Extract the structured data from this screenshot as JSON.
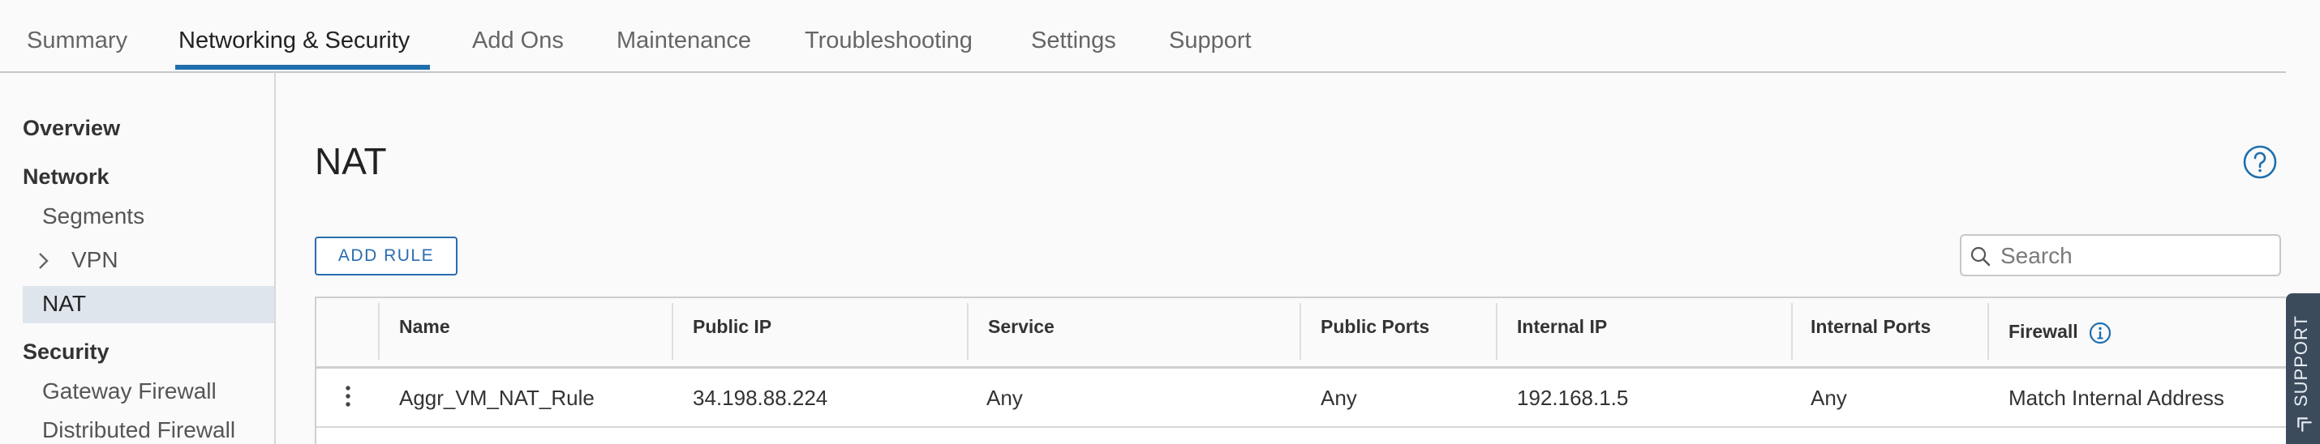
{
  "tabs": [
    {
      "label": "Summary"
    },
    {
      "label": "Networking & Security"
    },
    {
      "label": "Add Ons"
    },
    {
      "label": "Maintenance"
    },
    {
      "label": "Troubleshooting"
    },
    {
      "label": "Settings"
    },
    {
      "label": "Support"
    }
  ],
  "active_tab": "Networking & Security",
  "sidebar": {
    "overview": "Overview",
    "network_heading": "Network",
    "segments": "Segments",
    "vpn": "VPN",
    "nat": "NAT",
    "security_heading": "Security",
    "gateway_firewall": "Gateway Firewall",
    "distributed_firewall": "Distributed Firewall",
    "selected": "NAT"
  },
  "main": {
    "title": "NAT",
    "add_rule_label": "ADD RULE",
    "search_placeholder": "Search",
    "search_value": ""
  },
  "table": {
    "columns": [
      "Name",
      "Public IP",
      "Service",
      "Public Ports",
      "Internal IP",
      "Internal Ports",
      "Firewall"
    ],
    "rows": [
      {
        "name": "Aggr_VM_NAT_Rule",
        "public_ip": "34.198.88.224",
        "service": "Any",
        "public_ports": "Any",
        "internal_ip": "192.168.1.5",
        "internal_ports": "Any",
        "firewall": "Match Internal Address"
      }
    ]
  },
  "support_tab": {
    "label": "SUPPORT"
  },
  "icons": [
    "help-icon",
    "search-icon",
    "chevron-right-icon",
    "kebab-menu-icon",
    "info-icon",
    "chevron-double-up-icon"
  ],
  "colors": {
    "accent": "#1f6fad",
    "selected_bg": "#dfe5ec",
    "support_bg": "#3c4b5c"
  }
}
